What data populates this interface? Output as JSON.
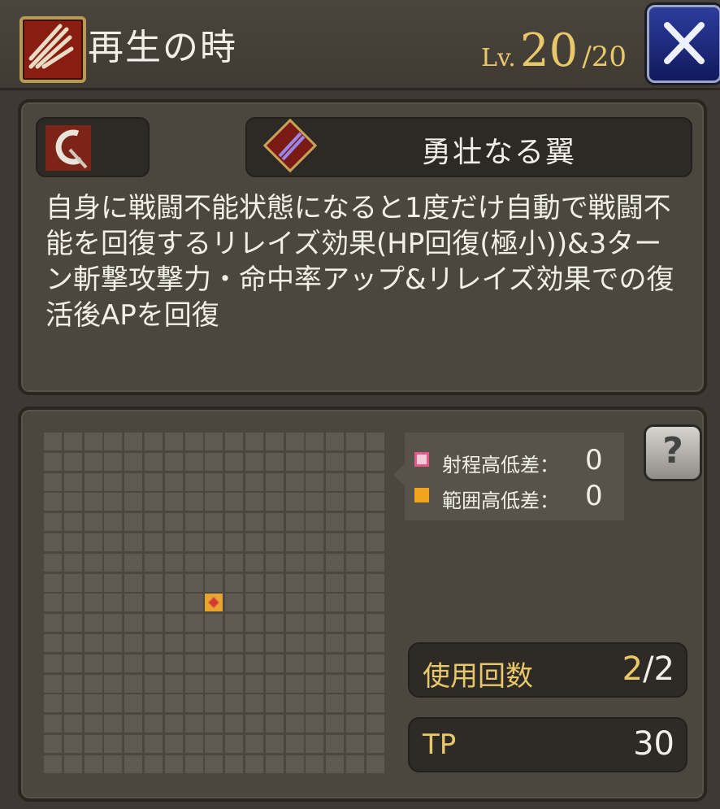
{
  "header": {
    "title": "再生の時",
    "level_prefix": "Lv.",
    "level_current": "20",
    "level_max": "/20"
  },
  "equipment": {
    "item_name": "勇壮なる翼"
  },
  "description": "自身に戦闘不能状態になると1度だけ自動で戦闘不能を回復するリレイズ効果(HP回復(極小))&3ターン斬撃攻撃力・命中率アップ&リレイズ効果での復活後APを回復",
  "range": {
    "legend": [
      {
        "label": "射程高低差：",
        "value": "0",
        "color": "#e25a8a"
      },
      {
        "label": "範囲高低差：",
        "value": "0",
        "color": "#f0a51e"
      }
    ]
  },
  "stats": {
    "uses_label": "使用回数",
    "uses_current": "2",
    "uses_max": "/2",
    "tp_label": "TP",
    "tp_value": "30"
  },
  "icons": {
    "skill": "claw-slash-icon",
    "slot": "scythe-icon",
    "item": "crossed-blades-icon",
    "close": "close-icon",
    "help": "help-book-icon"
  }
}
